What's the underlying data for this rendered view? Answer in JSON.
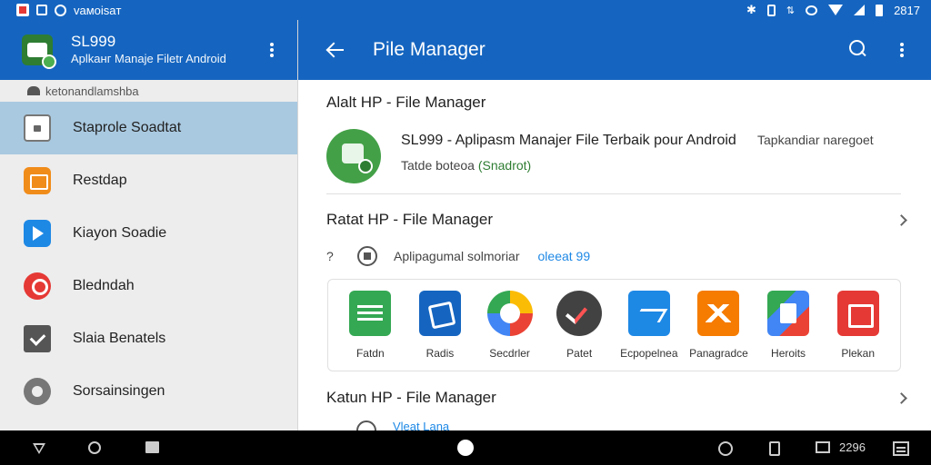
{
  "status_bar": {
    "app_label": "vaмoisaт",
    "time": "2817"
  },
  "drawer": {
    "title": "SL999",
    "subtitle": "Aplkанг Manaje Filetr Android",
    "account_text": "ketonandlamshba",
    "items": [
      {
        "label": "Staprole Soadtat",
        "icon": "clipboard-icon",
        "active": true
      },
      {
        "label": "Restdap",
        "icon": "book-icon",
        "active": false
      },
      {
        "label": "Kiayon Soadie",
        "icon": "play-icon",
        "active": false
      },
      {
        "label": "Bledndah",
        "icon": "location-pin-icon",
        "active": false
      },
      {
        "label": "Slaia Benatels",
        "icon": "folder-check-icon",
        "active": false
      },
      {
        "label": "Sorsainsingen",
        "icon": "gear-icon",
        "active": false
      }
    ]
  },
  "appbar": {
    "title": "Pile Manager"
  },
  "section1": {
    "title": "Alalt HP - File Manager",
    "app_name": "SL999 - Apliрasm Manajer File Terbaik pour Android",
    "publisher": "Tapkandiar naregoet",
    "subtitle_plain": "Tatde boteoa ",
    "subtitle_green": "(Snadrot)"
  },
  "section2": {
    "title": "Ratat HP - File Manager",
    "meta_q": "?",
    "meta_text": "Apliрagumal solmoriar",
    "meta_link": "oleeat 99",
    "apps": [
      {
        "label": "Fatdn"
      },
      {
        "label": "Radis"
      },
      {
        "label": "Secdrler"
      },
      {
        "label": "Patet"
      },
      {
        "label": "Ecpopelnea"
      },
      {
        "label": "Panagradce"
      },
      {
        "label": "Heroits"
      },
      {
        "label": "Plekan"
      }
    ]
  },
  "section3": {
    "title": "Katun HP - File Manager",
    "sub": "Vleat Lana"
  },
  "navbar": {
    "indicator_text": "2296"
  }
}
